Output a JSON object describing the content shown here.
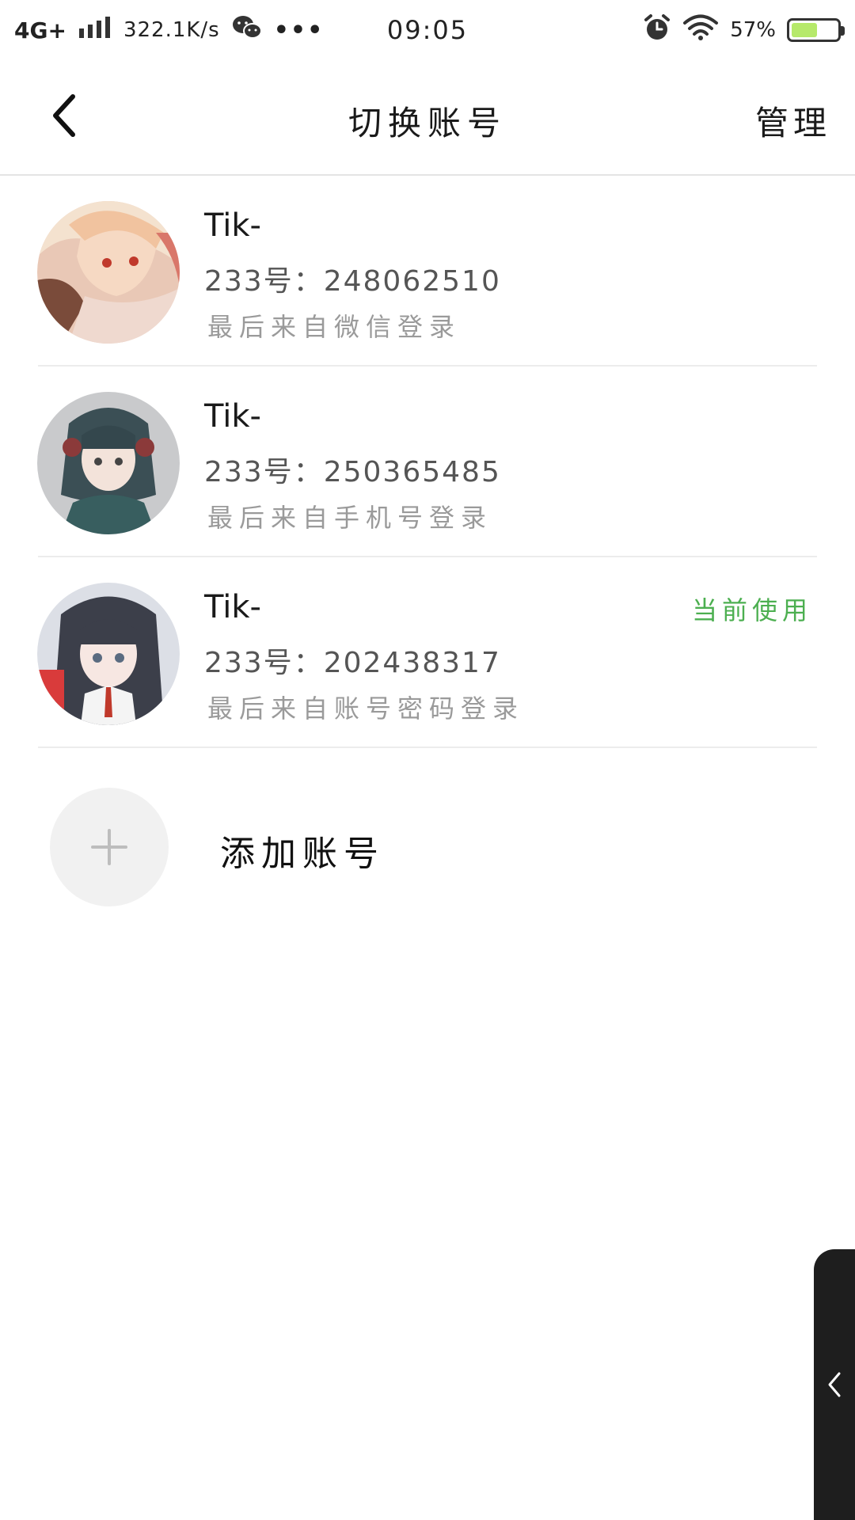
{
  "status_bar": {
    "network": "4G+",
    "speed": "322.1K/s",
    "time": "09:05",
    "battery_percent": "57%",
    "battery_level": 0.57,
    "icons": [
      "signal-icon",
      "wechat-icon",
      "more-dots-icon",
      "alarm-icon",
      "wifi-icon",
      "battery-icon"
    ]
  },
  "header": {
    "title": "切换账号",
    "manage_label": "管理",
    "back_icon": "chevron-left-icon"
  },
  "accounts": [
    {
      "name": "Tik-",
      "id_line": "233号：248062510",
      "source": "最后来自微信登录",
      "current_label": ""
    },
    {
      "name": "Tik-",
      "id_line": "233号：250365485",
      "source": "最后来自手机号登录",
      "current_label": ""
    },
    {
      "name": "Tik-",
      "id_line": "233号：202438317",
      "source": "最后来自账号密码登录",
      "current_label": "当前使用"
    }
  ],
  "add_account": {
    "label": "添加账号",
    "icon": "plus-icon"
  },
  "colors": {
    "accent_green": "#4caf50",
    "secondary_text": "#9a9a9a",
    "divider": "#ececec",
    "edge_tab": "#1e1e1e"
  }
}
